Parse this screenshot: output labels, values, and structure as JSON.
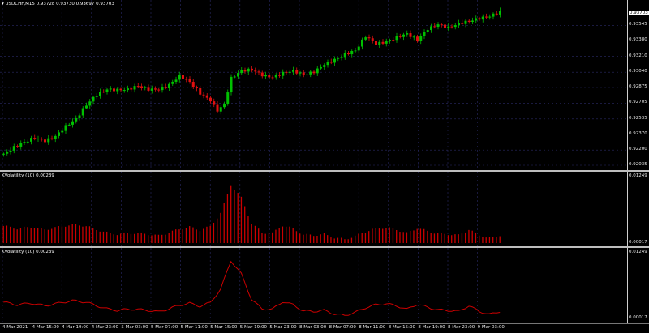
{
  "main": {
    "title": "USDCHF,M15  0.93728  0.93730  0.93697  0.93703",
    "current_price": "0.93703",
    "price_ticks": [
      "0.93545",
      "0.93380",
      "0.93210",
      "0.93040",
      "0.92875",
      "0.92705",
      "0.92535",
      "0.92370",
      "0.92200",
      "0.92035"
    ]
  },
  "indicator1": {
    "title": "KVolatility (10) 0.00239",
    "scale_max": "0.01249",
    "scale_min": "0.00017"
  },
  "indicator2": {
    "title": "KVolatility (10) 0.00239",
    "scale_max": "0.01249",
    "scale_min": "0.00017"
  },
  "time_axis": [
    "4 Mar 2021",
    "4 Mar 15:00",
    "4 Mar 19:00",
    "4 Mar 23:00",
    "5 Mar 03:00",
    "5 Mar 07:00",
    "5 Mar 11:00",
    "5 Mar 15:00",
    "5 Mar 19:00",
    "5 Mar 23:00",
    "8 Mar 03:00",
    "8 Mar 07:00",
    "8 Mar 11:00",
    "8 Mar 15:00",
    "8 Mar 19:00",
    "8 Mar 23:00",
    "9 Mar 03:00"
  ],
  "colors": {
    "bull": "#00c000",
    "bear": "#e01010",
    "grid": "#2a2a66",
    "vol": "#cc0000"
  },
  "chart_data": {
    "type": "candlestick",
    "symbol": "USDCHF",
    "timeframe": "M15",
    "ylim": [
      0.92035,
      0.9375
    ],
    "close_path": [
      [
        0,
        0.9216
      ],
      [
        3,
        0.9222
      ],
      [
        6,
        0.9227
      ],
      [
        9,
        0.9233
      ],
      [
        12,
        0.9231
      ],
      [
        15,
        0.9236
      ],
      [
        18,
        0.9245
      ],
      [
        21,
        0.9252
      ],
      [
        24,
        0.9268
      ],
      [
        27,
        0.9281
      ],
      [
        30,
        0.9287
      ],
      [
        33,
        0.9285
      ],
      [
        36,
        0.9284
      ],
      [
        39,
        0.9288
      ],
      [
        42,
        0.9286
      ],
      [
        45,
        0.9287
      ],
      [
        48,
        0.9291
      ],
      [
        51,
        0.9299
      ],
      [
        54,
        0.9292
      ],
      [
        57,
        0.9281
      ],
      [
        60,
        0.9275
      ],
      [
        62,
        0.9264
      ],
      [
        64,
        0.927
      ],
      [
        66,
        0.9297
      ],
      [
        69,
        0.9304
      ],
      [
        72,
        0.9306
      ],
      [
        75,
        0.9302
      ],
      [
        78,
        0.93
      ],
      [
        81,
        0.9303
      ],
      [
        84,
        0.9304
      ],
      [
        87,
        0.93
      ],
      [
        90,
        0.9305
      ],
      [
        93,
        0.9314
      ],
      [
        96,
        0.9318
      ],
      [
        99,
        0.9322
      ],
      [
        102,
        0.9326
      ],
      [
        105,
        0.9343
      ],
      [
        108,
        0.9336
      ],
      [
        111,
        0.9338
      ],
      [
        114,
        0.9341
      ],
      [
        117,
        0.9344
      ],
      [
        120,
        0.9338
      ],
      [
        123,
        0.9352
      ],
      [
        126,
        0.9357
      ],
      [
        129,
        0.9352
      ],
      [
        132,
        0.9355
      ],
      [
        135,
        0.9358
      ],
      [
        138,
        0.9363
      ],
      [
        141,
        0.9366
      ],
      [
        144,
        0.937
      ]
    ],
    "volatility": [
      [
        0,
        0.0035
      ],
      [
        4,
        0.003
      ],
      [
        8,
        0.0033
      ],
      [
        12,
        0.0028
      ],
      [
        16,
        0.0033
      ],
      [
        20,
        0.0038
      ],
      [
        24,
        0.0035
      ],
      [
        27,
        0.0028
      ],
      [
        30,
        0.0022
      ],
      [
        33,
        0.0019
      ],
      [
        36,
        0.0021
      ],
      [
        39,
        0.0021
      ],
      [
        42,
        0.0019
      ],
      [
        45,
        0.0016
      ],
      [
        48,
        0.0022
      ],
      [
        51,
        0.0029
      ],
      [
        54,
        0.0033
      ],
      [
        57,
        0.0027
      ],
      [
        60,
        0.0034
      ],
      [
        63,
        0.006
      ],
      [
        66,
        0.0116
      ],
      [
        69,
        0.009
      ],
      [
        72,
        0.004
      ],
      [
        75,
        0.0022
      ],
      [
        78,
        0.0021
      ],
      [
        81,
        0.0036
      ],
      [
        84,
        0.003
      ],
      [
        87,
        0.0018
      ],
      [
        90,
        0.0017
      ],
      [
        93,
        0.0019
      ],
      [
        96,
        0.0012
      ],
      [
        99,
        0.0009
      ],
      [
        102,
        0.0015
      ],
      [
        105,
        0.0024
      ],
      [
        108,
        0.003
      ],
      [
        111,
        0.0032
      ],
      [
        114,
        0.0028
      ],
      [
        117,
        0.0021
      ],
      [
        120,
        0.0031
      ],
      [
        123,
        0.0025
      ],
      [
        126,
        0.002
      ],
      [
        129,
        0.0019
      ],
      [
        132,
        0.0017
      ],
      [
        135,
        0.0028
      ],
      [
        138,
        0.0017
      ],
      [
        141,
        0.0011
      ],
      [
        144,
        0.0017
      ]
    ],
    "vol_ylim": [
      0.00017,
      0.01249
    ],
    "bars": 145
  }
}
